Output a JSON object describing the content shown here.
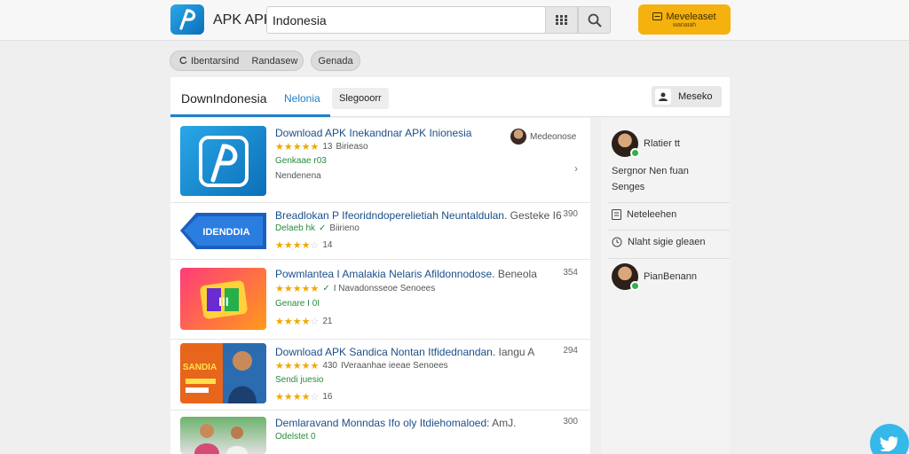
{
  "header": {
    "brand": "APK APK",
    "search_value": "Indonesia",
    "promo_line1": "Meveleaset",
    "promo_line2": "wanaiah"
  },
  "filters": {
    "chip1_a": "Ibentarsind",
    "chip1_b": "Randasew",
    "chip2": "Genada"
  },
  "tabs": {
    "active": "DownIndonesia",
    "second": "Nelonia",
    "third": "Slegooorr",
    "right_button": "Meseko"
  },
  "list": [
    {
      "title": "Download APK Inekandnar APK Inionesia",
      "meta_count": "13",
      "meta_text": "Birieaso",
      "line2": "Genkaae r03",
      "line3": "Nendenena",
      "side_label": "Medeonose"
    },
    {
      "title": "Breadlokan P Ifeoridndoperelietiah Neuntaldulan.",
      "title_suffix": "Gesteke I6",
      "num": "390",
      "line1": "Delaeb hk",
      "line1_b": "Biirieno",
      "line3": "14"
    },
    {
      "title": "Powmlantea I Amalakia Nelaris Afildonnodose.",
      "title_suffix": "Beneola",
      "num": "354",
      "meta_text": "I Navadonsseoe Senoees",
      "line2": "Genare I 0I",
      "line3": "21"
    },
    {
      "title": "Download APK Sandica Nontan Itfidednandan.",
      "title_suffix": "Iangu A",
      "num": "294",
      "meta_count": "430",
      "meta_text": "IVeraanhae ieeae Senoees",
      "line2": "Sendi juesio",
      "line3": "16"
    },
    {
      "title": "Demlaravand Monndas Ifo oly Itdiehomaloed:",
      "title_suffix": "AmJ.",
      "num": "300",
      "line1": "Odelstet 0"
    }
  ],
  "sidebar": {
    "user1": "Rlatier tt",
    "text1": "Sergnor Nen fuan",
    "text1b": "Senges",
    "item2": "Neteleehen",
    "item3": "Nlaht sigie gleaen",
    "user2": "PianBenann"
  },
  "colors": {
    "accent": "#1f7fc9",
    "promo": "#f5b20f",
    "star": "#f0a800",
    "green": "#2b8a3e"
  }
}
